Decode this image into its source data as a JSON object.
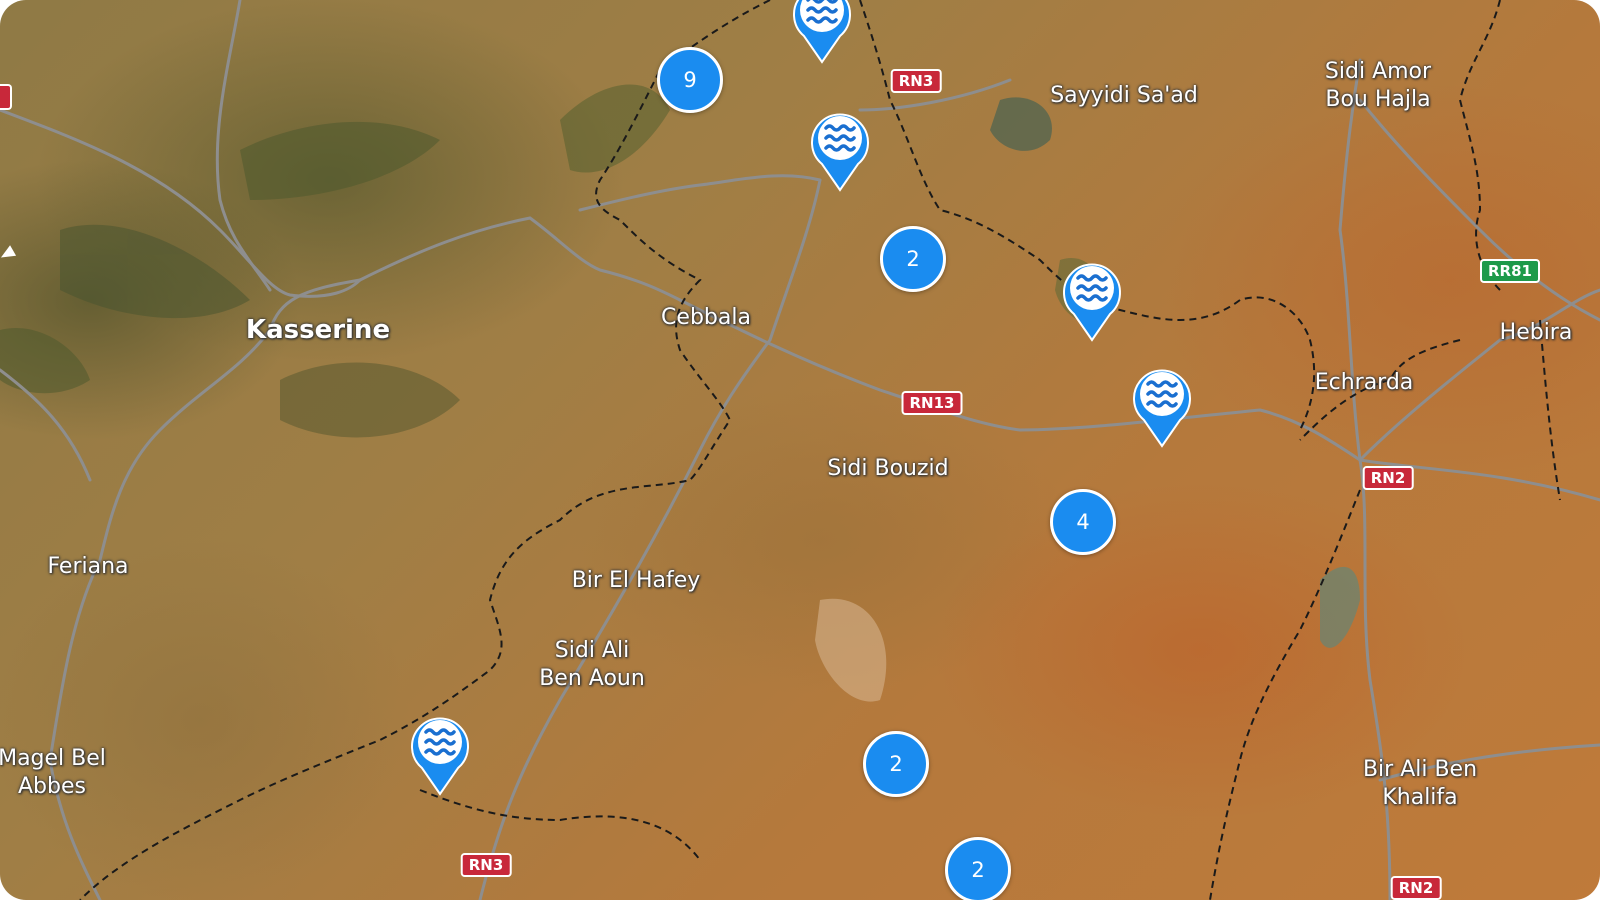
{
  "map": {
    "places": [
      {
        "id": "kasserine",
        "label": "Kasserine",
        "major": true
      },
      {
        "id": "cebbala",
        "label": "Cebbala",
        "major": false
      },
      {
        "id": "sayyidi-saad",
        "label": "Sayyidi Sa'ad",
        "major": false
      },
      {
        "id": "sidi-amor",
        "label": "Sidi Amor\nBou Hajla",
        "major": false
      },
      {
        "id": "hebira",
        "label": "Hebira",
        "major": false
      },
      {
        "id": "echrarda",
        "label": "Echrarda",
        "major": false
      },
      {
        "id": "sidi-bouzid",
        "label": "Sidi Bouzid",
        "major": false
      },
      {
        "id": "feriana",
        "label": "Feriana",
        "major": false
      },
      {
        "id": "bir-el-hafey",
        "label": "Bir El Hafey",
        "major": false
      },
      {
        "id": "sidi-ali",
        "label": "Sidi Ali\nBen Aoun",
        "major": false
      },
      {
        "id": "magel",
        "label": "Magel Bel\nAbbes",
        "major": false
      },
      {
        "id": "bir-ali",
        "label": "Bir Ali Ben\nKhalifa",
        "major": false
      }
    ],
    "road_labels": [
      {
        "id": "rn3-top",
        "label": "RN3",
        "color": "red"
      },
      {
        "id": "rn13",
        "label": "RN13",
        "color": "red"
      },
      {
        "id": "rr81",
        "label": "RR81",
        "color": "green"
      },
      {
        "id": "rn2-mid",
        "label": "RN2",
        "color": "red"
      },
      {
        "id": "rn3-bottom",
        "label": "RN3",
        "color": "red"
      },
      {
        "id": "rn2-bottom",
        "label": "RN2",
        "color": "red"
      }
    ],
    "clusters": [
      {
        "id": "c9",
        "count": "9"
      },
      {
        "id": "c2a",
        "count": "2"
      },
      {
        "id": "c4",
        "count": "4"
      },
      {
        "id": "c2b",
        "count": "2"
      },
      {
        "id": "c2c",
        "count": "2"
      }
    ],
    "water_pin_icon": "water-waves-icon",
    "colors": {
      "cluster": "#1a8cf0",
      "pin": "#1a8cf0",
      "road_red": "#c8283a",
      "road_green": "#1e9a4a"
    }
  }
}
